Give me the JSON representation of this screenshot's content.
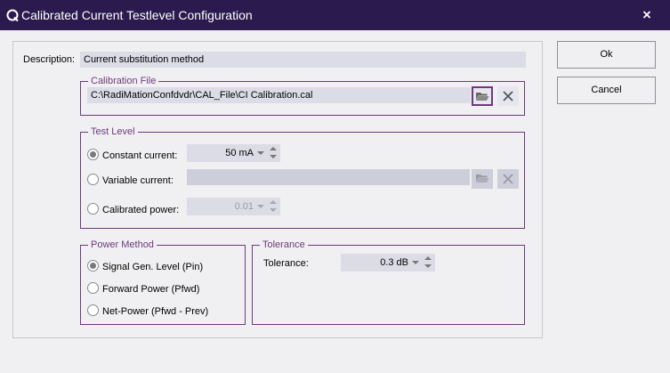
{
  "window": {
    "title": "Calibrated Current Testlevel Configuration",
    "app_icon": "q-logo-icon",
    "close_icon": "close-icon"
  },
  "description": {
    "label": "Description:",
    "value": "Current substitution method"
  },
  "calibration_file": {
    "legend": "Calibration File",
    "path": "C:\\RadiMationConfdvdr\\CAL_File\\CI Calibration.cal",
    "browse_icon": "folder-open-icon",
    "clear_icon": "close-icon"
  },
  "test_level": {
    "legend": "Test Level",
    "options": [
      {
        "label": "Constant current:",
        "checked": true,
        "value": "50 mA",
        "enabled": true
      },
      {
        "label": "Variable current:",
        "checked": false,
        "value": "",
        "enabled": false
      },
      {
        "label": "Calibrated power:",
        "checked": false,
        "value": "0.01",
        "enabled": false
      }
    ]
  },
  "power_method": {
    "legend": "Power Method",
    "options": [
      {
        "label": "Signal Gen. Level (Pin)",
        "checked": true
      },
      {
        "label": "Forward Power (Pfwd)",
        "checked": false
      },
      {
        "label": "Net-Power (Pfwd - Prev)",
        "checked": false
      }
    ]
  },
  "tolerance": {
    "legend": "Tolerance",
    "label": "Tolerance:",
    "value": "0.3 dB"
  },
  "buttons": {
    "ok": "Ok",
    "cancel": "Cancel"
  },
  "colors": {
    "titlebar": "#2b1a4d",
    "accent": "#6d3a7d",
    "field": "#dcdce6"
  }
}
